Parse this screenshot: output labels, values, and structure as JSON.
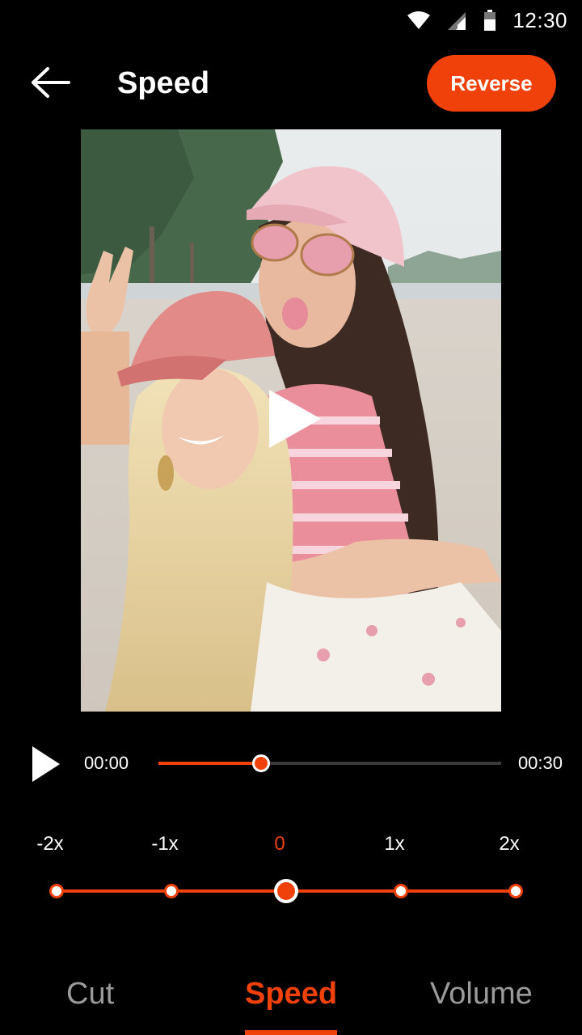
{
  "status_bar": {
    "time": "12:30",
    "icons": [
      "wifi-icon",
      "cellular-signal-icon",
      "battery-icon"
    ]
  },
  "header": {
    "back_icon": "arrow-left-icon",
    "title": "Speed",
    "reverse_label": "Reverse"
  },
  "video": {
    "play_icon": "play-icon"
  },
  "playback": {
    "play_icon": "play-icon",
    "current_time": "00:00",
    "total_time": "00:30",
    "progress": 0.3
  },
  "speed": {
    "options": [
      "-2x",
      "-1x",
      "0",
      "1x",
      "2x"
    ],
    "selected_index": 2
  },
  "tabs": {
    "items": [
      "Cut",
      "Speed",
      "Volume"
    ],
    "active": "Speed"
  },
  "colors": {
    "accent": "#f0410a",
    "background": "#000000",
    "inactive_tab": "#9a9a9a"
  }
}
